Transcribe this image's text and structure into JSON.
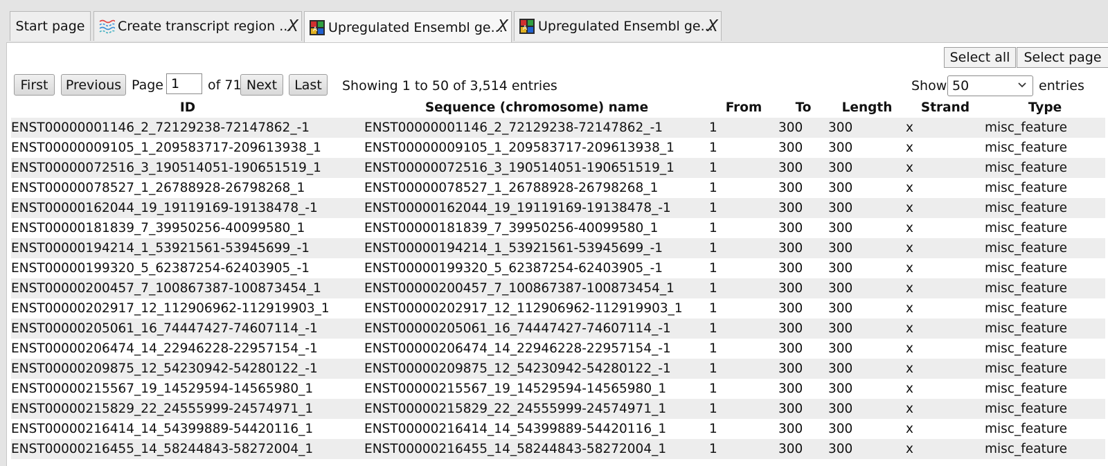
{
  "tabs": [
    {
      "label": "Start page"
    },
    {
      "label": "Create transcript region ...",
      "close": "X"
    },
    {
      "label": "Upregulated Ensembl ge...",
      "close": "X"
    },
    {
      "label": "Upregulated Ensembl ge...",
      "close": "X"
    }
  ],
  "toolbar": {
    "select_all": "Select all",
    "select_page": "Select page"
  },
  "pagination": {
    "first": "First",
    "previous": "Previous",
    "page_label": "Page",
    "page_value": "1",
    "of_label": "of 71",
    "next": "Next",
    "last": "Last",
    "showing": "Showing 1 to 50 of 3,514 entries",
    "show_label": "Show",
    "show_value": "50",
    "entries_label": "entries"
  },
  "table": {
    "columns": [
      "ID",
      "Sequence (chromosome) name",
      "From",
      "To",
      "Length",
      "Strand",
      "Type"
    ],
    "rows": [
      {
        "id": "ENST00000001146_2_72129238-72147862_-1",
        "seq": "ENST00000001146_2_72129238-72147862_-1",
        "from": "1",
        "to": "300",
        "length": "300",
        "strand": "x",
        "type": "misc_feature"
      },
      {
        "id": "ENST00000009105_1_209583717-209613938_1",
        "seq": "ENST00000009105_1_209583717-209613938_1",
        "from": "1",
        "to": "300",
        "length": "300",
        "strand": "x",
        "type": "misc_feature"
      },
      {
        "id": "ENST00000072516_3_190514051-190651519_1",
        "seq": "ENST00000072516_3_190514051-190651519_1",
        "from": "1",
        "to": "300",
        "length": "300",
        "strand": "x",
        "type": "misc_feature"
      },
      {
        "id": "ENST00000078527_1_26788928-26798268_1",
        "seq": "ENST00000078527_1_26788928-26798268_1",
        "from": "1",
        "to": "300",
        "length": "300",
        "strand": "x",
        "type": "misc_feature"
      },
      {
        "id": "ENST00000162044_19_19119169-19138478_-1",
        "seq": "ENST00000162044_19_19119169-19138478_-1",
        "from": "1",
        "to": "300",
        "length": "300",
        "strand": "x",
        "type": "misc_feature"
      },
      {
        "id": "ENST00000181839_7_39950256-40099580_1",
        "seq": "ENST00000181839_7_39950256-40099580_1",
        "from": "1",
        "to": "300",
        "length": "300",
        "strand": "x",
        "type": "misc_feature"
      },
      {
        "id": "ENST00000194214_1_53921561-53945699_-1",
        "seq": "ENST00000194214_1_53921561-53945699_-1",
        "from": "1",
        "to": "300",
        "length": "300",
        "strand": "x",
        "type": "misc_feature"
      },
      {
        "id": "ENST00000199320_5_62387254-62403905_-1",
        "seq": "ENST00000199320_5_62387254-62403905_-1",
        "from": "1",
        "to": "300",
        "length": "300",
        "strand": "x",
        "type": "misc_feature"
      },
      {
        "id": "ENST00000200457_7_100867387-100873454_1",
        "seq": "ENST00000200457_7_100867387-100873454_1",
        "from": "1",
        "to": "300",
        "length": "300",
        "strand": "x",
        "type": "misc_feature"
      },
      {
        "id": "ENST00000202917_12_112906962-112919903_1",
        "seq": "ENST00000202917_12_112906962-112919903_1",
        "from": "1",
        "to": "300",
        "length": "300",
        "strand": "x",
        "type": "misc_feature"
      },
      {
        "id": "ENST00000205061_16_74447427-74607114_-1",
        "seq": "ENST00000205061_16_74447427-74607114_-1",
        "from": "1",
        "to": "300",
        "length": "300",
        "strand": "x",
        "type": "misc_feature"
      },
      {
        "id": "ENST00000206474_14_22946228-22957154_-1",
        "seq": "ENST00000206474_14_22946228-22957154_-1",
        "from": "1",
        "to": "300",
        "length": "300",
        "strand": "x",
        "type": "misc_feature"
      },
      {
        "id": "ENST00000209875_12_54230942-54280122_-1",
        "seq": "ENST00000209875_12_54230942-54280122_-1",
        "from": "1",
        "to": "300",
        "length": "300",
        "strand": "x",
        "type": "misc_feature"
      },
      {
        "id": "ENST00000215567_19_14529594-14565980_1",
        "seq": "ENST00000215567_19_14529594-14565980_1",
        "from": "1",
        "to": "300",
        "length": "300",
        "strand": "x",
        "type": "misc_feature"
      },
      {
        "id": "ENST00000215829_22_24555999-24574971_1",
        "seq": "ENST00000215829_22_24555999-24574971_1",
        "from": "1",
        "to": "300",
        "length": "300",
        "strand": "x",
        "type": "misc_feature"
      },
      {
        "id": "ENST00000216414_14_54399889-54420116_1",
        "seq": "ENST00000216414_14_54399889-54420116_1",
        "from": "1",
        "to": "300",
        "length": "300",
        "strand": "x",
        "type": "misc_feature"
      },
      {
        "id": "ENST00000216455_14_58244843-58272004_1",
        "seq": "ENST00000216455_14_58244843-58272004_1",
        "from": "1",
        "to": "300",
        "length": "300",
        "strand": "x",
        "type": "misc_feature"
      }
    ]
  },
  "icons": {
    "tab1": "transcript-region-icon",
    "tab2": "table-icon",
    "tab3": "table-icon",
    "select_arrow": "chevron-down-icon"
  },
  "colors": {
    "row_stripe": "#ededed",
    "background": "#e4e4e4"
  }
}
